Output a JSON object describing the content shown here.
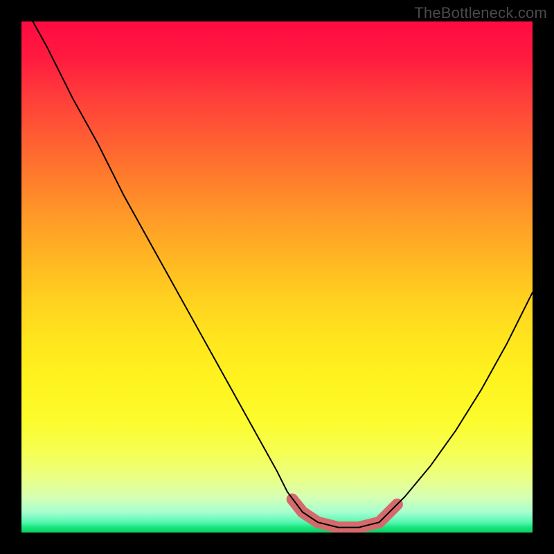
{
  "watermark": "TheBottleneck.com",
  "chart_data": {
    "type": "line",
    "title": "",
    "xlabel": "",
    "ylabel": "",
    "xlim": [
      0,
      100
    ],
    "ylim": [
      0,
      100
    ],
    "series": [
      {
        "name": "bottleneck-curve",
        "x": [
          0,
          5,
          10,
          15,
          20,
          25,
          30,
          35,
          40,
          45,
          50,
          52,
          55,
          58,
          62,
          66,
          70,
          72,
          75,
          80,
          85,
          90,
          95,
          100
        ],
        "y": [
          104,
          95,
          85,
          76,
          66,
          57,
          48,
          39,
          30,
          21,
          12,
          8,
          4,
          2,
          1,
          1,
          2,
          4,
          7,
          13,
          20,
          28,
          37,
          47
        ]
      }
    ],
    "highlight_range": {
      "name": "optimal-zone",
      "points": [
        {
          "x": 53,
          "y": 6.5
        },
        {
          "x": 55,
          "y": 4.0
        },
        {
          "x": 58,
          "y": 2.0
        },
        {
          "x": 62,
          "y": 1.0
        },
        {
          "x": 66,
          "y": 1.0
        },
        {
          "x": 70,
          "y": 2.0
        },
        {
          "x": 72,
          "y": 4.0
        },
        {
          "x": 73.5,
          "y": 5.5
        }
      ]
    },
    "colors": {
      "curve": "#000000",
      "highlight": "#d56a6c",
      "gradient_top": "#ff0b42",
      "gradient_bottom": "#0acf5d"
    }
  }
}
